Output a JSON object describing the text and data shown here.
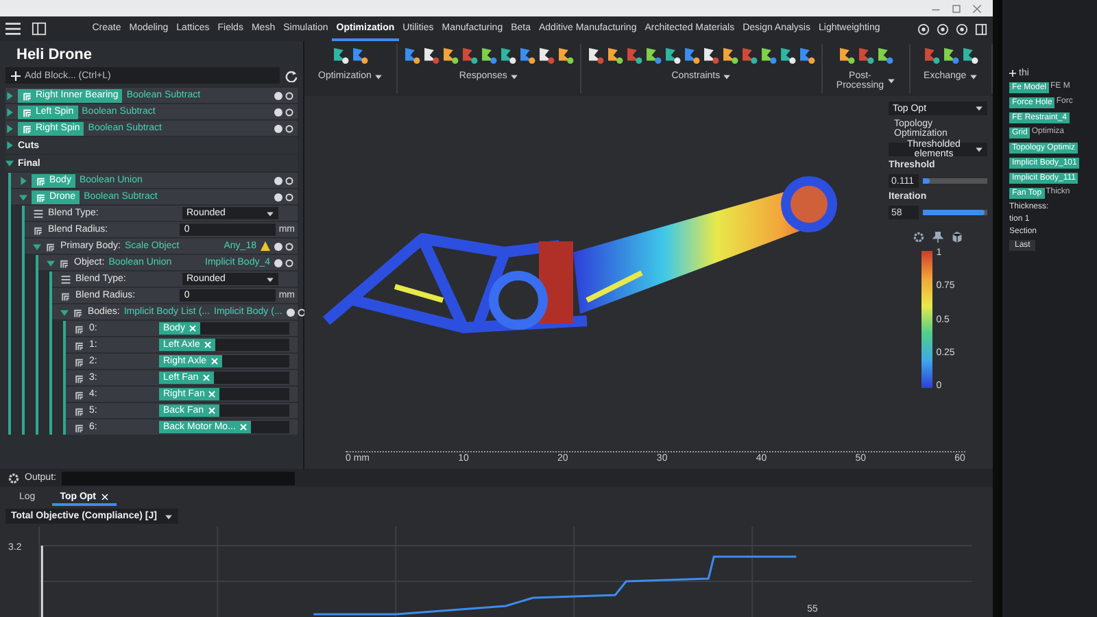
{
  "menu_tabs": [
    {
      "label": "Create",
      "selected": false
    },
    {
      "label": "Modeling",
      "selected": false
    },
    {
      "label": "Lattices",
      "selected": false
    },
    {
      "label": "Fields",
      "selected": false
    },
    {
      "label": "Mesh",
      "selected": false
    },
    {
      "label": "Simulation",
      "selected": false
    },
    {
      "label": "Optimization",
      "selected": true
    },
    {
      "label": "Utilities",
      "selected": false
    },
    {
      "label": "Manufacturing",
      "selected": false
    },
    {
      "label": "Beta",
      "selected": false
    },
    {
      "label": "Additive Manufacturing",
      "selected": false
    },
    {
      "label": "Architected Materials",
      "selected": false
    },
    {
      "label": "Design Analysis",
      "selected": false
    },
    {
      "label": "Lightweighting",
      "selected": false
    }
  ],
  "toolbar_groups": [
    {
      "label": "Optimization"
    },
    {
      "label": "Responses"
    },
    {
      "label": "Constraints"
    },
    {
      "label": "Post-Processing"
    },
    {
      "label": "Exchange"
    }
  ],
  "sidebar": {
    "title": "Heli Drone",
    "add_block": {
      "placeholder": "Add Block... (Ctrl+L)"
    },
    "tree": [
      {
        "kind": "block",
        "name": "Right Inner Bearing",
        "type": "Boolean Subtract",
        "expanded": false
      },
      {
        "kind": "block",
        "name": "Left Spin",
        "type": "Boolean Subtract",
        "expanded": false
      },
      {
        "kind": "block",
        "name": "Right Spin",
        "type": "Boolean Subtract",
        "expanded": false
      },
      {
        "kind": "section",
        "label": "Cuts",
        "expanded": false
      },
      {
        "kind": "section",
        "label": "Final",
        "expanded": true,
        "children": [
          {
            "kind": "block",
            "name": "Body",
            "type": "Boolean Union",
            "expanded": false
          },
          {
            "kind": "block",
            "name": "Drone",
            "type": "Boolean Subtract",
            "expanded": true,
            "children": [
              {
                "kind": "dropdown",
                "label": "Blend Type:",
                "value": "Rounded"
              },
              {
                "kind": "number",
                "label": "Blend Radius:",
                "value": "0",
                "unit": "mm"
              },
              {
                "kind": "input",
                "name": "Primary Body:",
                "type": "Scale Object",
                "ref": "Any_18",
                "warning": true,
                "expanded": true,
                "children": [
                  {
                    "kind": "input",
                    "name": "Object:",
                    "type": "Boolean Union",
                    "ref": "Implicit Body_4",
                    "expanded": true,
                    "children": [
                      {
                        "kind": "dropdown",
                        "label": "Blend Type:",
                        "value": "Rounded"
                      },
                      {
                        "kind": "number",
                        "label": "Blend Radius:",
                        "value": "0",
                        "unit": "mm"
                      },
                      {
                        "kind": "input",
                        "name": "Bodies:",
                        "type": "Implicit Body List (...",
                        "ref": "Implicit Body (...",
                        "expanded": true,
                        "children": [
                          {
                            "kind": "entry",
                            "label": "0:",
                            "value": "Body"
                          },
                          {
                            "kind": "entry",
                            "label": "1:",
                            "value": "Left Axle"
                          },
                          {
                            "kind": "entry",
                            "label": "2:",
                            "value": "Right Axle"
                          },
                          {
                            "kind": "entry",
                            "label": "3:",
                            "value": "Left Fan"
                          },
                          {
                            "kind": "entry",
                            "label": "4:",
                            "value": "Right Fan"
                          },
                          {
                            "kind": "entry",
                            "label": "5:",
                            "value": "Back Fan"
                          },
                          {
                            "kind": "entry",
                            "label": "6:",
                            "value": "Back Motor Mo..."
                          }
                        ]
                      }
                    ]
                  }
                ]
              }
            ]
          }
        ]
      }
    ]
  },
  "viewport": {
    "ruler_labels": [
      "0 mm",
      "10",
      "20",
      "30",
      "40",
      "50",
      "60"
    ],
    "panel": {
      "dropdown": "Top Opt",
      "title": "Topology Optimization",
      "mode": "Thresholded elements",
      "sliders": [
        {
          "label": "Threshold",
          "value": "0.111",
          "level": 0.1
        },
        {
          "label": "Iteration",
          "value": "58",
          "level": 0.95
        }
      ],
      "legend_ticks": [
        "1",
        "0.75",
        "0.5",
        "0.25",
        "0"
      ]
    }
  },
  "output": {
    "label": "Output:"
  },
  "bottom_tabs": [
    {
      "label": "Log",
      "selected": false,
      "closable": false
    },
    {
      "label": "Top Opt",
      "selected": true,
      "closable": true
    }
  ],
  "metric": {
    "value": "Total Objective (Compliance) [J]"
  },
  "chart": {
    "y_label": "3.2",
    "x_label": "55"
  },
  "second_monitor": {
    "add": "thi",
    "items": [
      {
        "name": "Fe Model",
        "type": "FE M"
      },
      {
        "name": "Force Hole",
        "type": "Forc"
      },
      {
        "name": "FE Restraint_4"
      },
      {
        "name": "Grid",
        "type": "Optimiza"
      },
      {
        "name": "Topology Optimiz"
      },
      {
        "name": "Implicit Body_101"
      },
      {
        "name": "Implicit Body_111"
      },
      {
        "name": "Fan Top",
        "type": "Thickn"
      }
    ],
    "texts": [
      "Thickness:",
      "tion 1",
      "Section",
      "Last"
    ]
  }
}
